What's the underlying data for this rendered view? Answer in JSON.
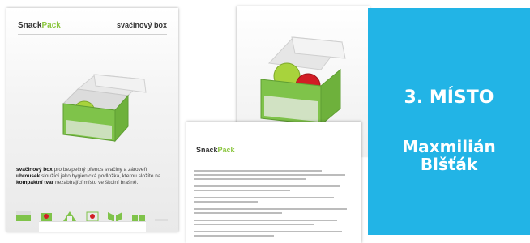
{
  "left_sheet": {
    "brand_main": "Snack",
    "brand_accent": "Pack",
    "title": "svačinový box",
    "desc_bold1": "svačinový box",
    "desc_text1": " pro bezpečný přenos svačiny a zároveň ",
    "desc_bold2": "ubrousek",
    "desc_text2": " sloužící jako hygienická podložka, kterou složíte na ",
    "desc_bold3": "kompaktní tvar",
    "desc_text3": " nezabírající místo ve školní brašně."
  },
  "middle_sheet": {
    "brand_main": "Snack",
    "brand_accent": "Pack"
  },
  "panel": {
    "rank": "3. MÍSTO",
    "name_first": "Maxmilián",
    "name_last": "Blšťák"
  },
  "colors": {
    "panel_bg": "#22b4e6",
    "brand_green": "#8bc63f"
  }
}
